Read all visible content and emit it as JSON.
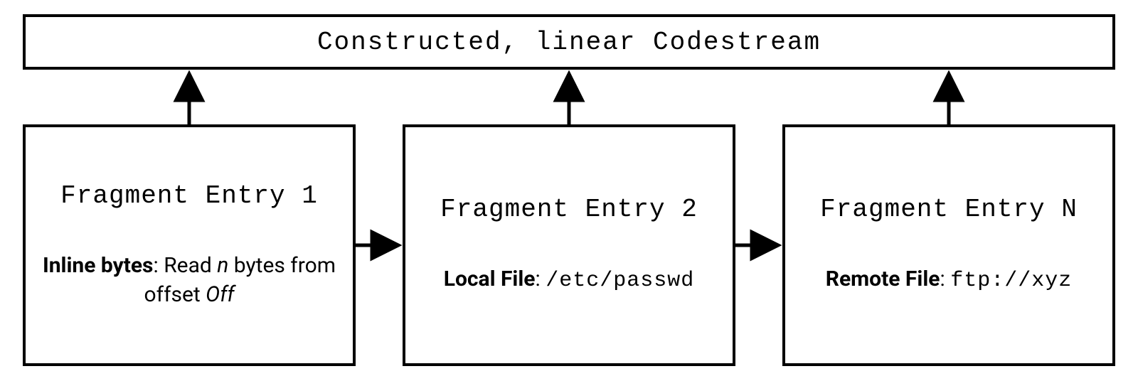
{
  "diagram": {
    "top_title": "Constructed, linear Codestream",
    "fragments": [
      {
        "title": "Fragment Entry 1",
        "desc_strong": "Inline bytes",
        "desc_sep": ": ",
        "desc_prefix": "Read ",
        "desc_var1": "n",
        "desc_mid": " bytes from offset ",
        "desc_var2": "Off"
      },
      {
        "title": "Fragment Entry 2",
        "desc_strong": "Local File",
        "desc_sep": ": ",
        "desc_value": "/etc/passwd"
      },
      {
        "title": "Fragment Entry N",
        "desc_strong": "Remote File",
        "desc_sep": ": ",
        "desc_value": "ftp://xyz"
      }
    ]
  }
}
